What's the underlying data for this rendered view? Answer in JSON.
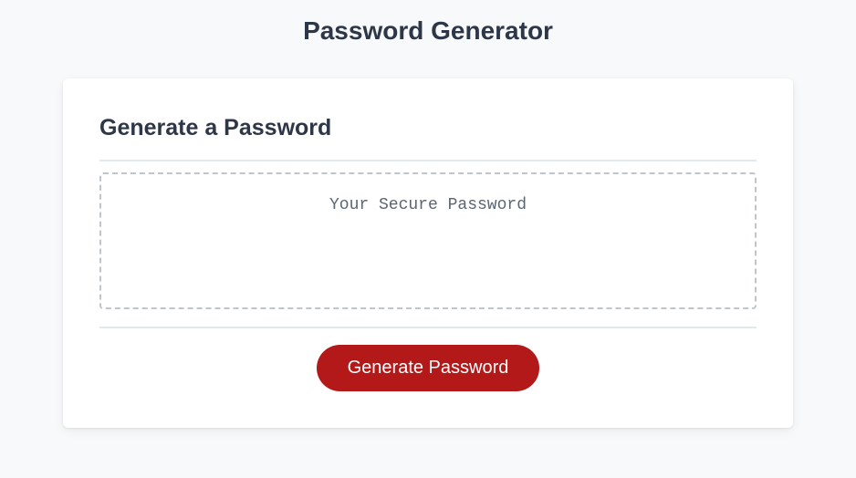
{
  "page": {
    "title": "Password Generator"
  },
  "card": {
    "heading": "Generate a Password",
    "password_value": "",
    "password_placeholder": "Your Secure Password",
    "generate_button_label": "Generate Password"
  },
  "colors": {
    "accent": "#b31919",
    "background": "#f8f9fa",
    "card_bg": "#ffffff",
    "text_primary": "#2d3748",
    "border": "#e2e8f0",
    "dashed_border": "#c0c4cc"
  }
}
